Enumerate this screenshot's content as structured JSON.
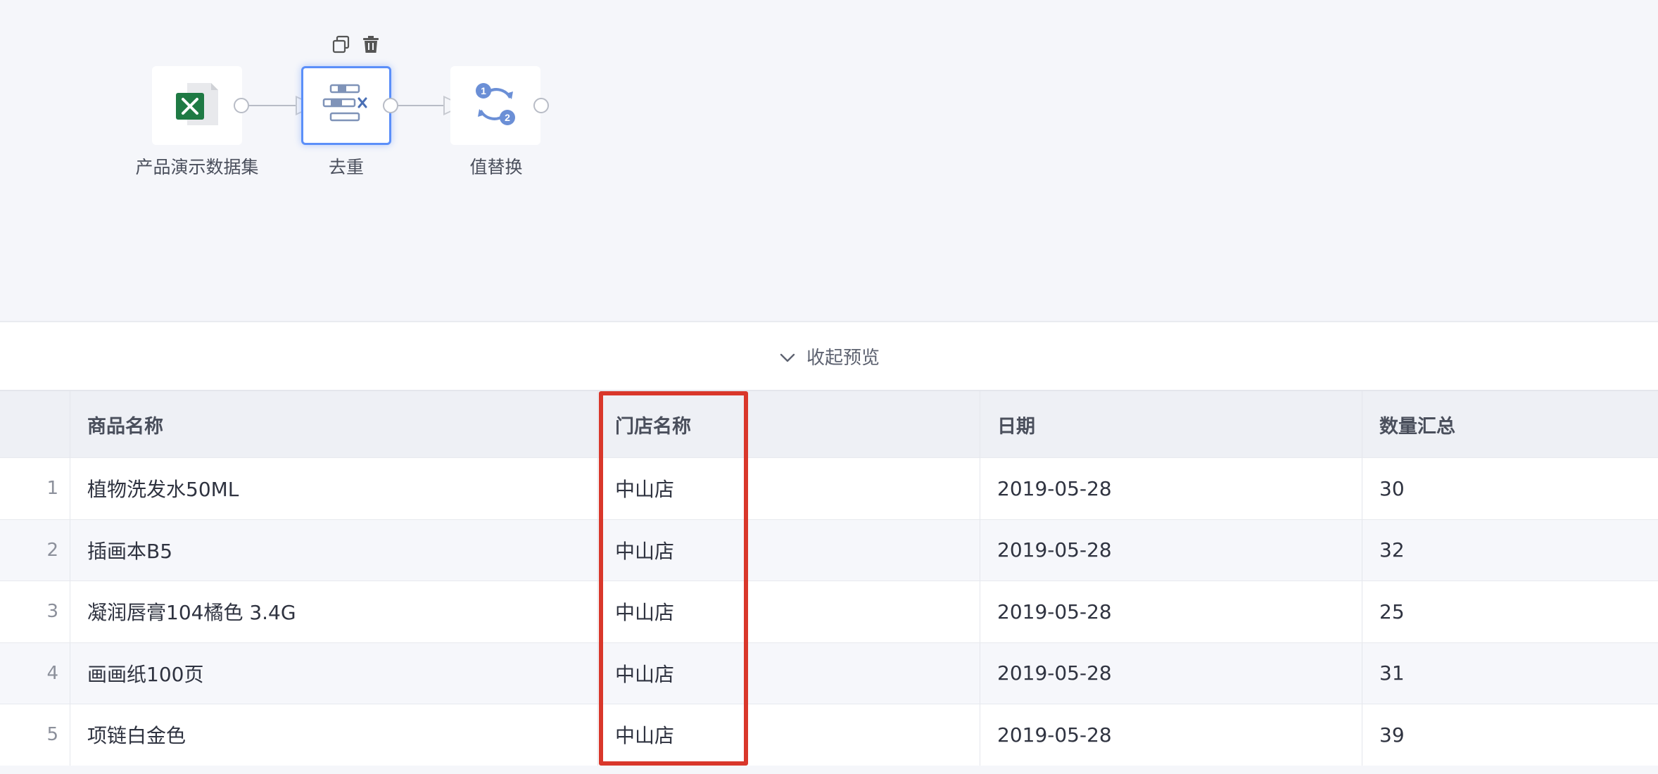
{
  "toolbar": {
    "copy_icon": "copy-icon",
    "delete_icon": "trash-icon"
  },
  "nodes": [
    {
      "label": "产品演示数据集",
      "icon": "excel-icon"
    },
    {
      "label": "去重",
      "icon": "dedup-icon"
    },
    {
      "label": "值替换",
      "icon": "value-replace-icon"
    }
  ],
  "preview": {
    "toggle_label": "收起预览"
  },
  "table": {
    "columns": [
      "",
      "商品名称",
      "门店名称",
      "日期",
      "数量汇总"
    ],
    "rows": [
      {
        "idx": "1",
        "name": "植物洗发水50ML",
        "store": "中山店",
        "date": "2019-05-28",
        "qty": "30"
      },
      {
        "idx": "2",
        "name": "插画本B5",
        "store": "中山店",
        "date": "2019-05-28",
        "qty": "32"
      },
      {
        "idx": "3",
        "name": "凝润唇膏104橘色 3.4G",
        "store": "中山店",
        "date": "2019-05-28",
        "qty": "25"
      },
      {
        "idx": "4",
        "name": "画画纸100页",
        "store": "中山店",
        "date": "2019-05-28",
        "qty": "31"
      },
      {
        "idx": "5",
        "name": "项链白金色",
        "store": "中山店",
        "date": "2019-05-28",
        "qty": "39"
      }
    ]
  },
  "colors": {
    "highlight": "#d9372b",
    "selected_border": "#5b8ff9",
    "excel_green": "#1f7a44",
    "icon_blue": "#6b8fd6"
  }
}
